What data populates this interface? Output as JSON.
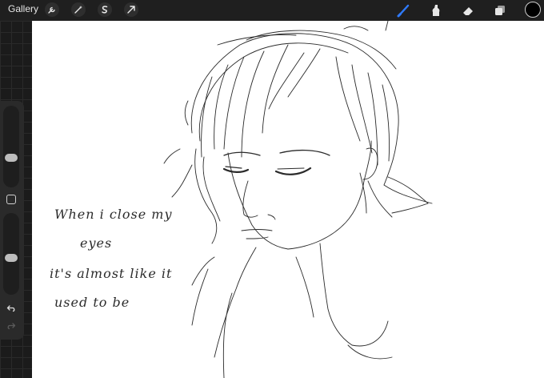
{
  "topbar": {
    "gallery_label": "Gallery",
    "left_tools": [
      "wrench-icon",
      "magic-wand-icon",
      "selection-icon",
      "transform-arrow-icon"
    ],
    "right_tools": [
      "brush-icon",
      "smudge-icon",
      "eraser-icon",
      "layers-icon"
    ],
    "active_tool": "brush-icon",
    "active_color": "#000000",
    "accent_color": "#2f7bff"
  },
  "sidebar": {
    "brush_size_level": 0.35,
    "opacity_level": 0.45
  },
  "canvas": {
    "handwriting": {
      "line1": "When i close my",
      "line2": "eyes",
      "line3": "it's almost like it",
      "line4": "used to be"
    }
  }
}
